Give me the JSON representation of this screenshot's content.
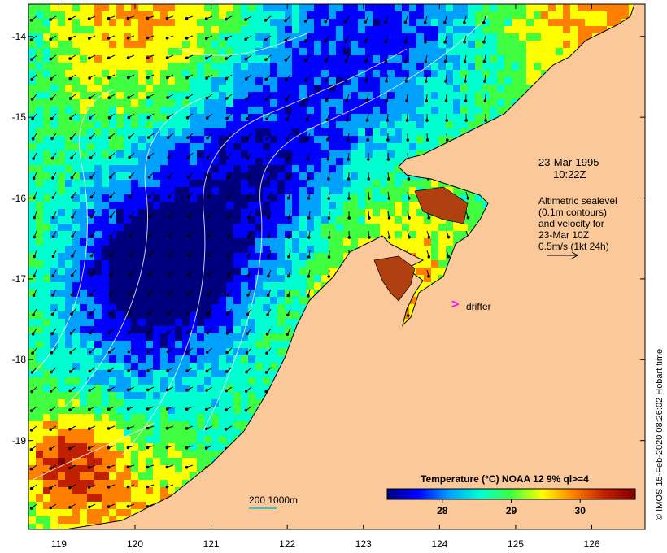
{
  "axes": {
    "lon_ticks": [
      "119",
      "120",
      "121",
      "122",
      "123",
      "124",
      "125",
      "126"
    ],
    "lat_ticks": [
      "-14",
      "-15",
      "-16",
      "-17",
      "-18",
      "-19"
    ],
    "lon_range": [
      118.6,
      126.7
    ],
    "lat_range": [
      -13.6,
      -20.1
    ]
  },
  "annotations": {
    "date": "23-Mar-1995",
    "time": "10:22Z",
    "legend_line1": "Altimetric sealevel",
    "legend_line2": "(0.1m contours)",
    "legend_line3": "and velocity for",
    "legend_line4": "23-Mar 10Z",
    "legend_line5": "0.5m/s (1kt 24h)",
    "drifter_label": "drifter",
    "drifter_symbol": ">",
    "scale_label": "200  1000m"
  },
  "colorbar": {
    "title": "Temperature (°C) NOAA 12 9% ql>=4",
    "ticks": [
      "28",
      "29",
      "30"
    ],
    "tick_values": [
      28,
      29,
      30
    ],
    "range": [
      27.2,
      30.8
    ],
    "colors": [
      "#00007f",
      "#0000ff",
      "#00a0ff",
      "#00ffd0",
      "#40ff40",
      "#ffff00",
      "#ff8000",
      "#c02000",
      "#7f0000"
    ]
  },
  "credit": "© IMOS 15-Feb-2020 08:26:02 Hobart time",
  "colors": {
    "land": "#fbc899",
    "drifter": "#ff00ff",
    "contour": "#ffffff",
    "arrow": "#000000"
  }
}
